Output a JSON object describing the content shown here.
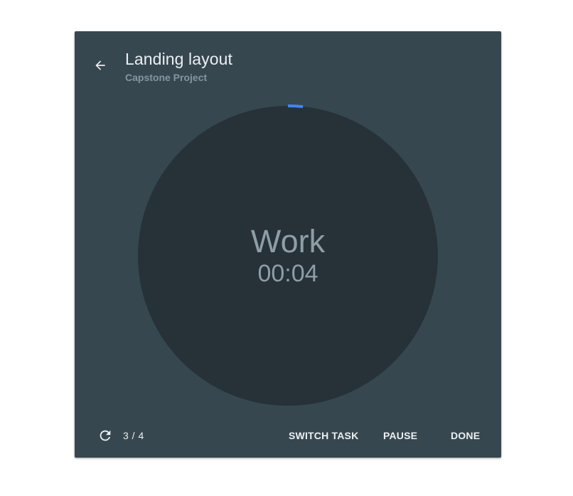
{
  "header": {
    "title": "Landing layout",
    "subtitle": "Capstone Project",
    "back_icon": "arrow-back-icon"
  },
  "timer": {
    "phase": "Work",
    "time": "00:04",
    "progress": 0.016,
    "colors": {
      "dial": "#263238",
      "progress": "#4285f4"
    }
  },
  "footer": {
    "repeat_icon": "refresh-icon",
    "round_count": "3 / 4",
    "switch_task_label": "SWITCH TASK",
    "pause_label": "PAUSE",
    "done_label": "DONE"
  },
  "colors": {
    "card_background": "#37474f",
    "page_background": "#ffffff"
  }
}
